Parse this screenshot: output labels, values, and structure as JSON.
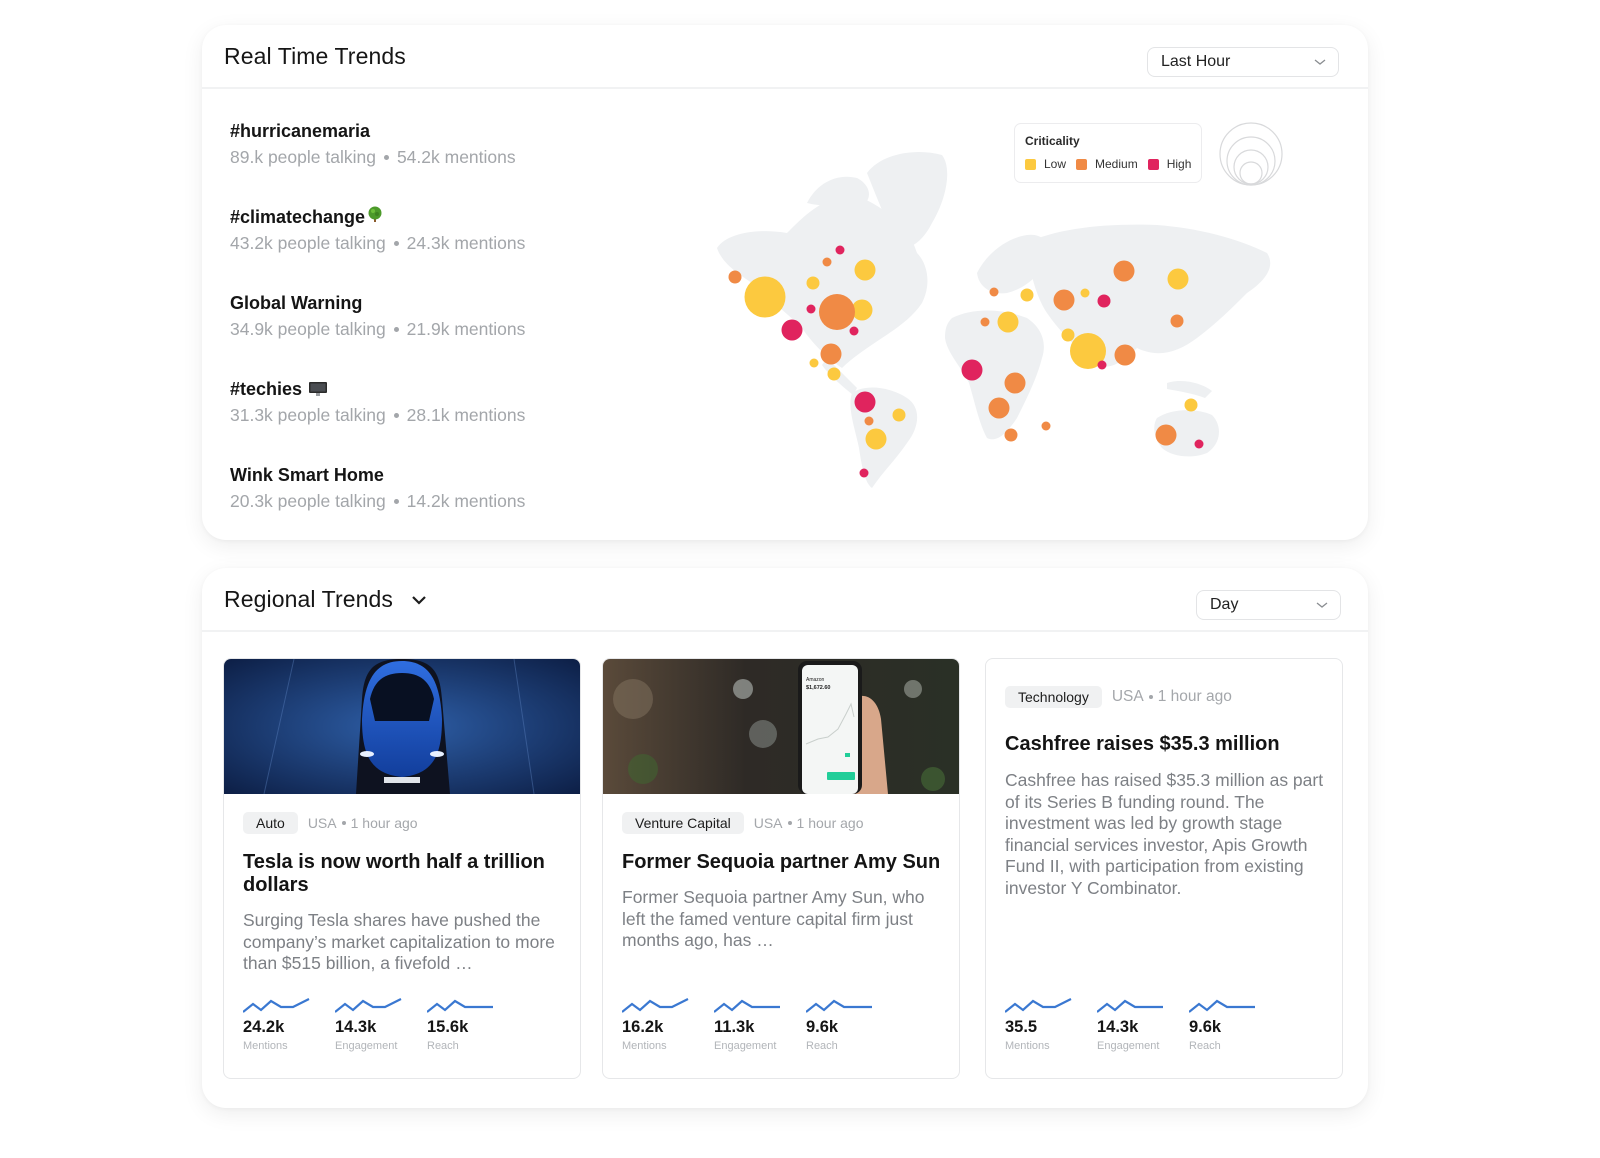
{
  "realtime": {
    "title": "Real Time Trends",
    "time_select": {
      "value": "Last Hour",
      "icon": "chevron-down-icon"
    },
    "trends": [
      {
        "title": "#hurricanemaria",
        "emoji": null,
        "people": "89.k people talking",
        "mentions": "54.2k mentions"
      },
      {
        "title": "#climatechange",
        "emoji": "tree-emoji",
        "people": "43.2k people talking",
        "mentions": "24.3k mentions"
      },
      {
        "title": "Global Warning",
        "emoji": null,
        "people": "34.9k people talking",
        "mentions": "21.9k mentions"
      },
      {
        "title": "#techies",
        "emoji": "desktop-computer-emoji",
        "people": "31.3k people talking",
        "mentions": "28.1k mentions"
      },
      {
        "title": "Wink Smart Home",
        "emoji": null,
        "people": "20.3k people talking",
        "mentions": "14.2k mentions"
      }
    ],
    "legend": {
      "title": "Criticality",
      "items": [
        {
          "label": "Low",
          "color": "#fcc93f"
        },
        {
          "label": "Medium",
          "color": "#f08a45"
        },
        {
          "label": "High",
          "color": "#e0245e"
        }
      ],
      "size_icon": "bubble-size-icon"
    },
    "map": {
      "land_color": "#eef0f2",
      "bubbles": [
        {
          "region": "Alaska",
          "level": "Medium",
          "size": "s"
        },
        {
          "region": "Western Canada",
          "level": "Low",
          "size": "xl"
        },
        {
          "region": "Northern Canada",
          "level": "Medium",
          "size": "xs"
        },
        {
          "region": "Arctic Canada",
          "level": "High",
          "size": "xs"
        },
        {
          "region": "Central Canada",
          "level": "Low",
          "size": "s"
        },
        {
          "region": "Eastern Canada",
          "level": "Low",
          "size": "m"
        },
        {
          "region": "Quebec",
          "level": "Low",
          "size": "m"
        },
        {
          "region": "Midwest US",
          "level": "High",
          "size": "xs"
        },
        {
          "region": "Central US",
          "level": "Medium",
          "size": "l"
        },
        {
          "region": "Western US",
          "level": "High",
          "size": "m"
        },
        {
          "region": "Eastern US",
          "level": "High",
          "size": "xs"
        },
        {
          "region": "Southern US",
          "level": "Medium",
          "size": "m"
        },
        {
          "region": "Mexico",
          "level": "Low",
          "size": "xs"
        },
        {
          "region": "Central America",
          "level": "Low",
          "size": "s"
        },
        {
          "region": "Colombia",
          "level": "High",
          "size": "m"
        },
        {
          "region": "Brazil North",
          "level": "Low",
          "size": "s"
        },
        {
          "region": "Peru",
          "level": "Medium",
          "size": "xs"
        },
        {
          "region": "Brazil South",
          "level": "Low",
          "size": "m"
        },
        {
          "region": "Argentina",
          "level": "High",
          "size": "xs"
        },
        {
          "region": "UK",
          "level": "Medium",
          "size": "xs"
        },
        {
          "region": "Scandinavia",
          "level": "Low",
          "size": "s"
        },
        {
          "region": "Spain",
          "level": "Medium",
          "size": "xs"
        },
        {
          "region": "Central Europe",
          "level": "Low",
          "size": "m"
        },
        {
          "region": "Western Russia",
          "level": "Medium",
          "size": "m"
        },
        {
          "region": "Ural",
          "level": "Low",
          "size": "xs"
        },
        {
          "region": "Kazakhstan",
          "level": "High",
          "size": "s"
        },
        {
          "region": "Siberia",
          "level": "Medium",
          "size": "m"
        },
        {
          "region": "Eastern Siberia",
          "level": "Low",
          "size": "m"
        },
        {
          "region": "Middle East",
          "level": "Low",
          "size": "s"
        },
        {
          "region": "India",
          "level": "Low",
          "size": "l"
        },
        {
          "region": "Bangladesh",
          "level": "High",
          "size": "xs"
        },
        {
          "region": "China",
          "level": "Medium",
          "size": "m"
        },
        {
          "region": "Korea",
          "level": "Medium",
          "size": "s"
        },
        {
          "region": "West Africa",
          "level": "High",
          "size": "m"
        },
        {
          "region": "Central Africa",
          "level": "Medium",
          "size": "m"
        },
        {
          "region": "Congo",
          "level": "Medium",
          "size": "m"
        },
        {
          "region": "South Africa",
          "level": "Medium",
          "size": "s"
        },
        {
          "region": "Madagascar",
          "level": "Medium",
          "size": "xs"
        },
        {
          "region": "Indonesia",
          "level": "Low",
          "size": "s"
        },
        {
          "region": "Western Australia",
          "level": "Medium",
          "size": "m"
        },
        {
          "region": "Eastern Australia",
          "level": "High",
          "size": "xs"
        }
      ]
    }
  },
  "regional": {
    "title": "Regional Trends",
    "title_icon": "chevron-down-icon",
    "time_select": {
      "value": "Day",
      "icon": "chevron-down-icon"
    },
    "cards": [
      {
        "image": "tesla-car-photo",
        "tag": "Auto",
        "country": "USA",
        "time": "1 hour ago",
        "title": "Tesla is now worth half a trillion dollars",
        "description": "Surging Tesla shares have pushed the company’s market capitalization to more than $515 billion, a fivefold …",
        "stats": [
          {
            "value": "24.2k",
            "label": "Mentions"
          },
          {
            "value": "14.3k",
            "label": "Engagement"
          },
          {
            "value": "15.6k",
            "label": "Reach"
          }
        ]
      },
      {
        "image": "phone-stock-app-photo",
        "phone_text": {
          "ticker": "Amazon",
          "price": "$1,672.60"
        },
        "tag": "Venture Capital",
        "country": "USA",
        "time": "1 hour ago",
        "title": "Former Sequoia partner Amy Sun",
        "description": "Former Sequoia partner Amy Sun, who left the famed venture capital firm just months ago, has …",
        "stats": [
          {
            "value": "16.2k",
            "label": "Mentions"
          },
          {
            "value": "11.3k",
            "label": "Engagement"
          },
          {
            "value": "9.6k",
            "label": "Reach"
          }
        ]
      },
      {
        "image": null,
        "tag": "Technology",
        "country": "USA",
        "time": "1 hour ago",
        "title": "Cashfree raises $35.3 million",
        "description": "Cashfree has raised $35.3 million as part of its Series B funding round. The investment was led by growth stage financial services investor, Apis Growth Fund II, with participation from existing investor Y Combinator.",
        "stats": [
          {
            "value": "35.5",
            "label": "Mentions"
          },
          {
            "value": "14.3k",
            "label": "Engagement"
          },
          {
            "value": "9.6k",
            "label": "Reach"
          }
        ]
      }
    ],
    "sparkline_color": "#3a78d1"
  }
}
